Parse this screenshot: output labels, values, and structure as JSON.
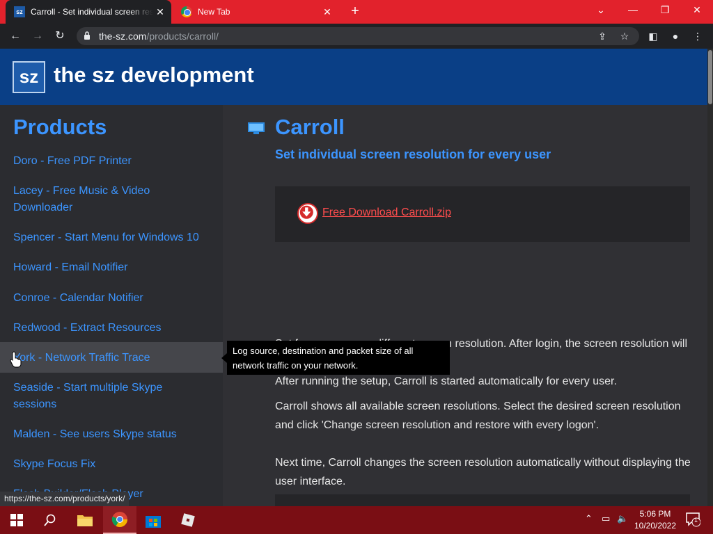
{
  "browser": {
    "tabs": [
      {
        "title": "Carroll - Set individual screen resolution",
        "favicon": "sz-favicon",
        "active": true
      },
      {
        "title": "New Tab",
        "favicon": "chrome-icon",
        "active": false
      }
    ],
    "url_host": "the-sz.com",
    "url_path": "/products/carroll/"
  },
  "site": {
    "logo_text": "sz",
    "brand": "the sz development"
  },
  "sidebar": {
    "heading": "Products",
    "items": [
      {
        "line1": "Doro - Free PDF Printer",
        "line2": ""
      },
      {
        "line1": "Lacey - Free Music & Video",
        "line2": "Downloader"
      },
      {
        "line1": "Spencer - Start Menu for Windows 10",
        "line2": ""
      },
      {
        "line1": "Howard - Email Notifier",
        "line2": ""
      },
      {
        "line1": "Conroe - Calendar Notifier",
        "line2": ""
      },
      {
        "line1": "Redwood - Extract Resources",
        "line2": ""
      },
      {
        "line1": "York - Network Traffic Trace",
        "line2": ""
      },
      {
        "line1": "Seaside - Start multiple Skype",
        "line2": "sessions"
      },
      {
        "line1": "Malden - See users Skype status",
        "line2": ""
      },
      {
        "line1": "Skype Focus Fix",
        "line2": ""
      },
      {
        "line1": "Flash Builder/Flash Player",
        "line2": ""
      }
    ],
    "hovered_index": 6
  },
  "main": {
    "title": "Carroll",
    "subtitle": "Set individual screen resolution for every user",
    "download_label": "Free Download Carroll.zip",
    "paragraphs": [
      "Set for every user a different screen resolution. After login, the screen resolution will be changed to the stored setting.",
      "After running the setup, Carroll is started automatically for every user.",
      "Carroll shows all available screen resolutions. Select the desired screen resolution and click 'Change screen resolution and restore with every logon'.",
      "Next time, Carroll changes the screen resolution automatically without displaying the user interface."
    ]
  },
  "tooltip": "Log source, destination and packet size of all network traffic on your network.",
  "status_url": "https://the-sz.com/products/york/",
  "taskbar": {
    "time": "5:06 PM",
    "date": "10/20/2022",
    "notification_count": "1"
  },
  "colors": {
    "accent": "#3c95ff",
    "header": "#0a3f86",
    "tabstrip": "#e2222c",
    "taskbar": "#7a0e14"
  }
}
